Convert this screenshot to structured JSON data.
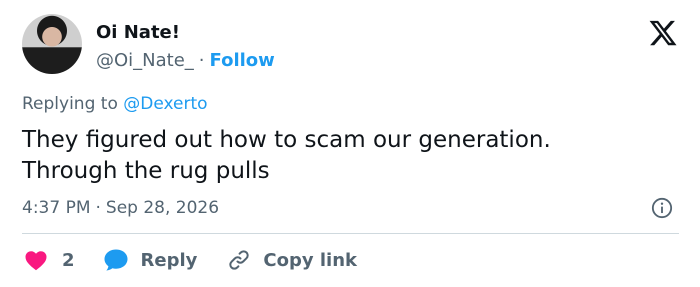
{
  "user": {
    "display_name": "Oi Nate!",
    "handle": "@Oi_Nate_",
    "separator": "·",
    "follow_label": "Follow"
  },
  "reply_context": {
    "prefix": "Replying to ",
    "mention": "@Dexerto"
  },
  "tweet": {
    "text_line1": "They figured out how to scam our generation.",
    "text_line2": "Through the rug pulls"
  },
  "meta": {
    "time": "4:37 PM",
    "separator": "·",
    "date": "Sep 28, 2026"
  },
  "actions": {
    "like_count": "2",
    "reply_label": "Reply",
    "copy_label": "Copy link"
  },
  "icons": {
    "logo": "x-logo-icon",
    "info": "info-icon",
    "like": "heart-icon",
    "reply": "speech-bubble-icon",
    "copy": "link-icon"
  },
  "colors": {
    "accent": "#1d9bf0",
    "like": "#f91880",
    "text": "#0f1419",
    "secondary": "#536471"
  }
}
